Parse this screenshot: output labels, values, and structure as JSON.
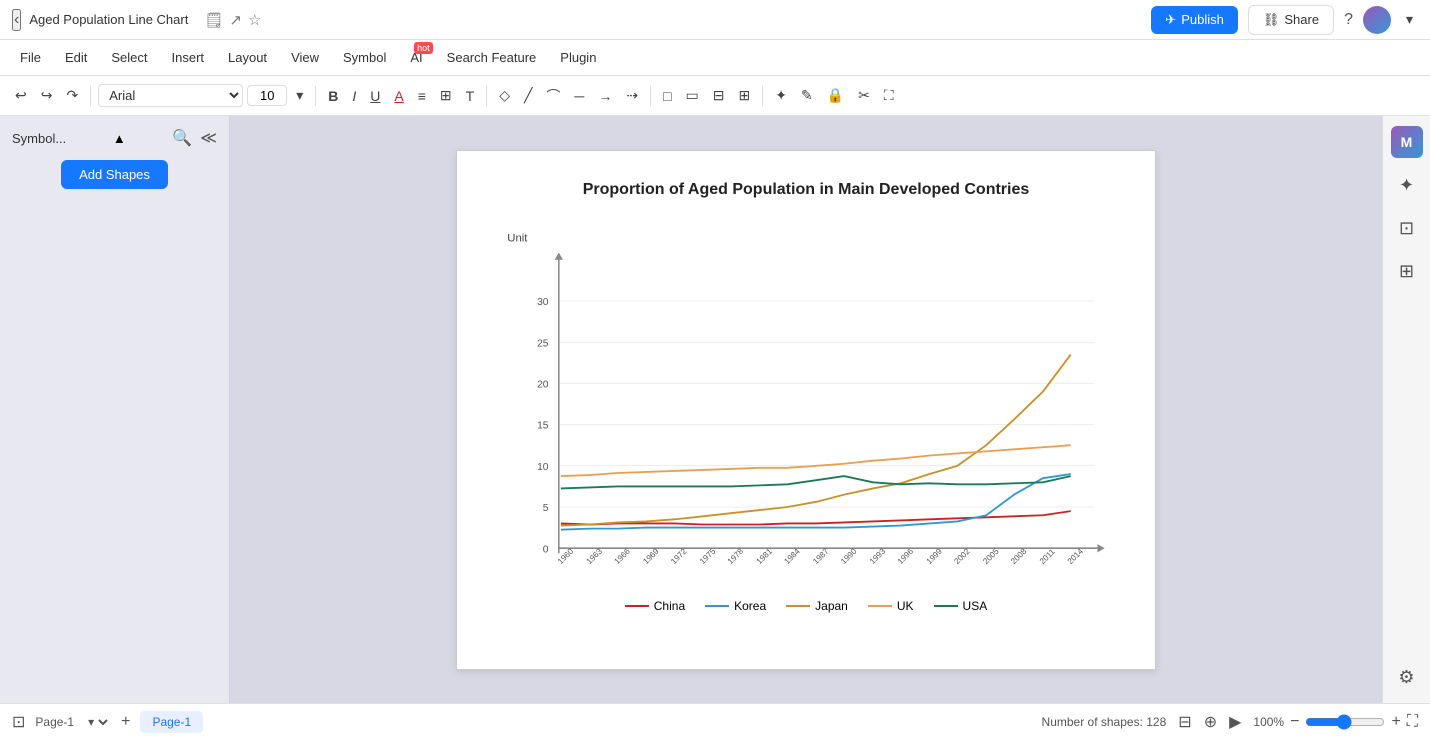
{
  "app": {
    "title": "Aged Population Line Chart",
    "publish_label": "Publish",
    "share_label": "Share"
  },
  "menu": {
    "items": [
      "File",
      "Edit",
      "Select",
      "Insert",
      "Layout",
      "View",
      "Symbol",
      "AI",
      "Search Feature",
      "Plugin"
    ]
  },
  "toolbar": {
    "font": "Arial",
    "font_size": "10",
    "undo_label": "↩",
    "redo_label": "↪"
  },
  "sidebar": {
    "title": "Symbol...",
    "add_shapes_label": "Add Shapes"
  },
  "chart": {
    "title": "Proportion of Aged Population in Main Developed Contries",
    "y_label": "Unit",
    "y_ticks": [
      "0",
      "5",
      "10",
      "15",
      "20",
      "25",
      "30"
    ],
    "x_ticks": [
      "1960",
      "1963",
      "1966",
      "1969",
      "1972",
      "1975",
      "1978",
      "1981",
      "1984",
      "1987",
      "1990",
      "1993",
      "1996",
      "1999",
      "2002",
      "2005",
      "2008",
      "2011",
      "2014"
    ],
    "legend": [
      {
        "label": "China",
        "color": "#cc2222"
      },
      {
        "label": "Korea",
        "color": "#3399cc"
      },
      {
        "label": "Japan",
        "color": "#d4a020"
      },
      {
        "label": "UK",
        "color": "#e8a050"
      },
      {
        "label": "USA",
        "color": "#1a7a5a"
      }
    ]
  },
  "statusbar": {
    "page_label": "Page-1",
    "active_page": "Page-1",
    "shapes_count": "Number of shapes: 128",
    "focus_label": "Focus",
    "zoom_level": "100%"
  },
  "icons": {
    "back": "‹",
    "bookmark": "🔖",
    "export": "↗",
    "star": "☆",
    "publish_icon": "✈",
    "share_icon": "⛓",
    "help": "?",
    "search": "🔍",
    "collapse": "≪",
    "bold": "B",
    "italic": "I",
    "underline": "U",
    "align_left": "≡",
    "paint": "🎨",
    "undo": "↩",
    "redo": "↪",
    "forward": "↷"
  }
}
